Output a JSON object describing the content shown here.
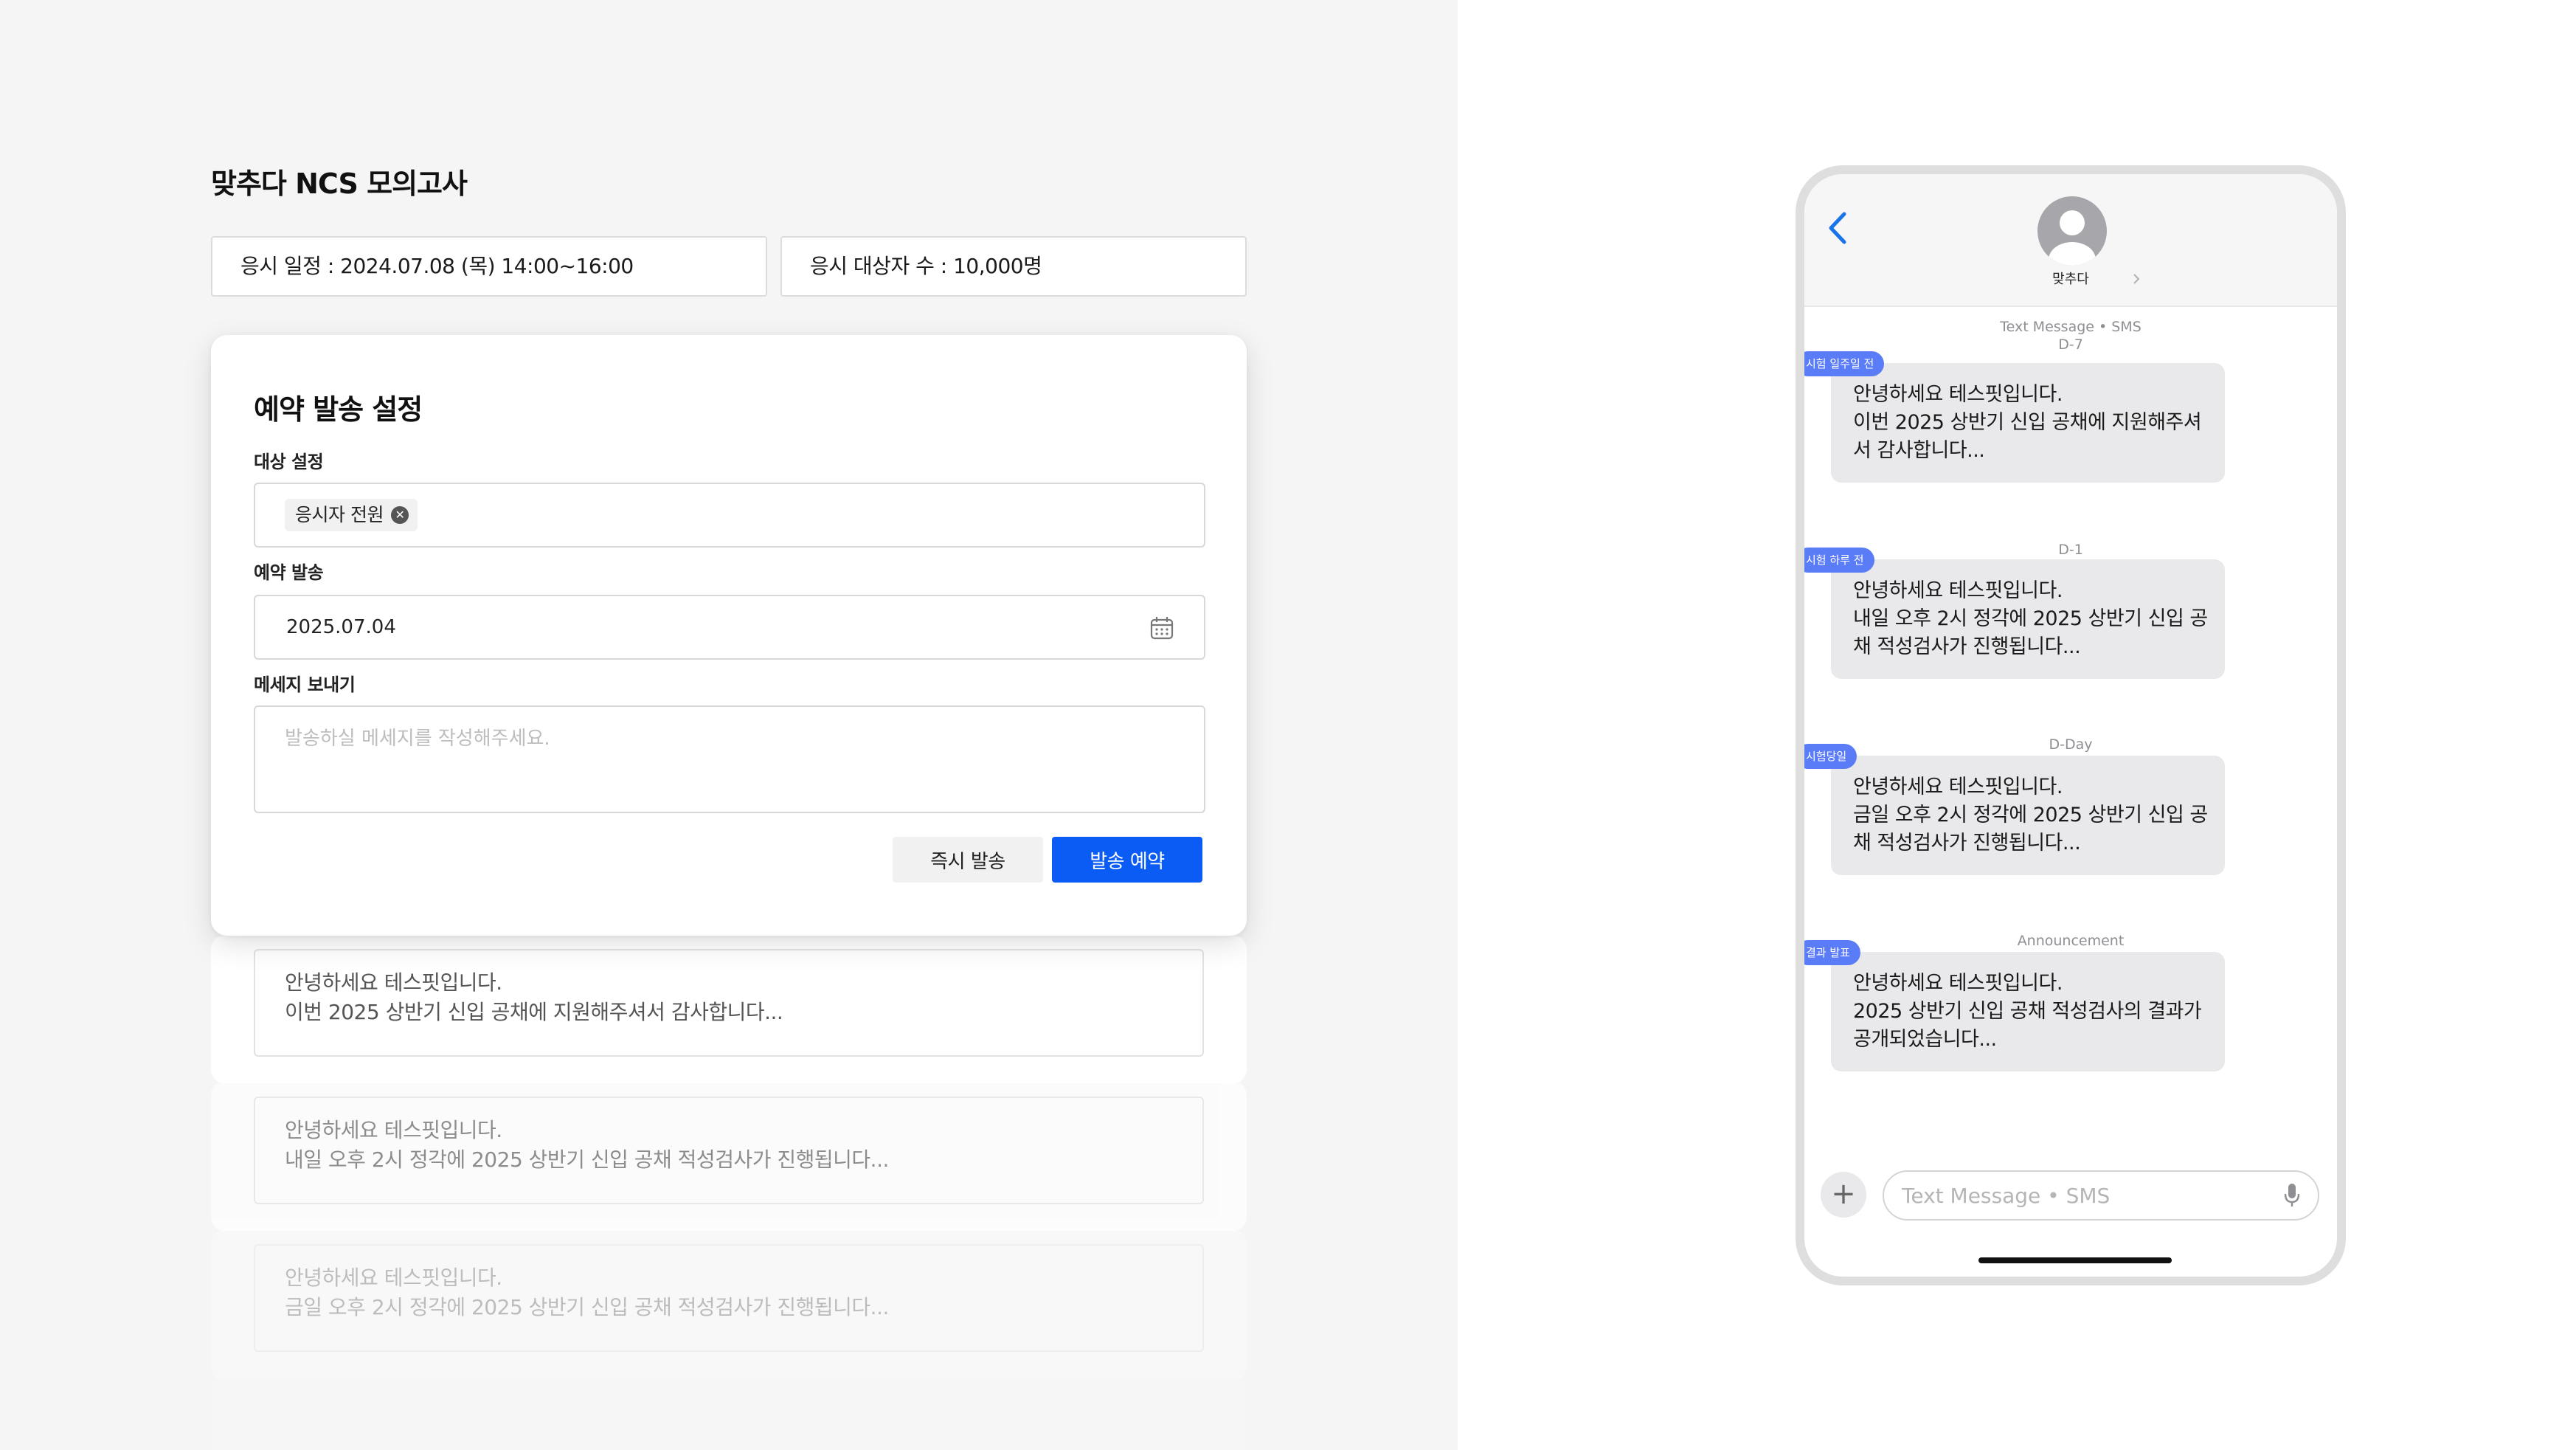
{
  "admin": {
    "exam_title": "맞추다 NCS 모의고사",
    "schedule": "응시 일정 : 2024.07.08 (목) 14:00~16:00",
    "candidate_count": "응시 대상자 수 : 10,000명",
    "modal": {
      "title": "예약 발송 설정",
      "target_label": "대상 설정",
      "target_chip": "응시자 전원",
      "date_label": "예약 발송",
      "date_value": "2025.07.04",
      "message_label": "메세지 보내기",
      "message_placeholder": "발송하실 메세지를 작성해주세요.",
      "send_now": "즉시 발송",
      "schedule_send": "발송 예약"
    },
    "history": [
      {
        "line1": "안녕하세요 테스핏입니다.",
        "line2": "이번 2025 상반기 신입 공채에 지원해주셔서 감사합니다..."
      },
      {
        "line1": "안녕하세요 테스핏입니다.",
        "line2": "내일 오후 2시 정각에 2025 상반기 신입 공채 적성검사가 진행됩니다..."
      },
      {
        "line1": "안녕하세요 테스핏입니다.",
        "line2": "금일 오후 2시 정각에 2025 상반기 신입 공채 적성검사가 진행됩니다..."
      }
    ]
  },
  "phone": {
    "contact_name": "맞추다",
    "input_placeholder": "Text Message • SMS",
    "messages": [
      {
        "timestamp": "Text Message • SMS",
        "sub": "D-7",
        "tag": "시험 일주일 전",
        "lines": [
          "안녕하세요 테스핏입니다.",
          "이번 2025 상반기 신입 공채에 지원해주셔",
          "서 감사합니다..."
        ]
      },
      {
        "timestamp": "D-1",
        "tag": "시험 하루 전",
        "lines": [
          "안녕하세요 테스핏입니다.",
          "내일 오후 2시 정각에 2025 상반기 신입 공",
          "채 적성검사가 진행됩니다..."
        ]
      },
      {
        "timestamp": "D-Day",
        "tag": "시험당일",
        "lines": [
          "안녕하세요 테스핏입니다.",
          "금일 오후 2시 정각에 2025 상반기 신입 공",
          "채 적성검사가 진행됩니다..."
        ]
      },
      {
        "timestamp": "Announcement",
        "tag": "결과 발표",
        "lines": [
          "안녕하세요 테스핏입니다.",
          "2025 상반기 신입 공채 적성검사의 결과가",
          "공개되었습니다..."
        ]
      }
    ]
  },
  "colors": {
    "primary_button": "#0a5cf5",
    "tag": "#5b7cf7",
    "left_background": "#f5f5f5",
    "bubble": "#e9e9eb",
    "back_arrow": "#1a73e8"
  },
  "icons": [
    "calendar-icon",
    "clear-chip-icon",
    "back-chevron-icon",
    "avatar-icon",
    "chevron-right-icon",
    "plus-icon",
    "mic-icon"
  ]
}
